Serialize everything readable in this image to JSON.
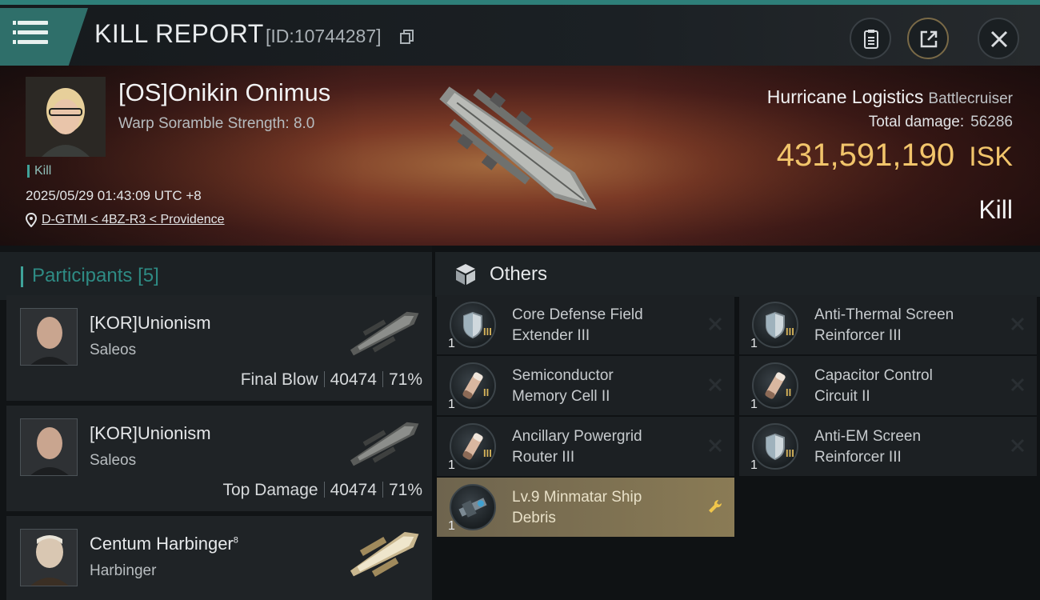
{
  "header": {
    "title": "KILL REPORT",
    "report_id": "[ID:10744287]"
  },
  "victim": {
    "name": "[OS]Onikin Onimus",
    "warp_scramble": "Warp Soramble Strength: 8.0",
    "kill_tag": "Kill",
    "timestamp": "2025/05/29 01:43:09 UTC +8",
    "location": "D-GTMI < 4BZ-R3 < Providence",
    "ship": "Hurricane Logistics",
    "ship_class": "Battlecruiser",
    "total_damage_label": "Total damage:",
    "total_damage": "56286",
    "isk_value": "431,591,190",
    "isk_unit": "ISK",
    "result": "Kill"
  },
  "participants": {
    "label": "Participants",
    "count": "[5]",
    "rows": [
      {
        "name": "[KOR]Unionism",
        "ship": "Saleos",
        "role": "Final Blow",
        "damage": "40474",
        "percent": "71%"
      },
      {
        "name": "[KOR]Unionism",
        "ship": "Saleos",
        "role": "Top Damage",
        "damage": "40474",
        "percent": "71%"
      },
      {
        "name": "Centum Harbinger",
        "name_sup": "8",
        "ship": "Harbinger"
      }
    ]
  },
  "others": {
    "label": "Others",
    "items": [
      {
        "name": "Core Defense Field Extender III",
        "line1": "Core Defense Field",
        "line2": "Extender III",
        "qty": "1",
        "tier": "III",
        "icon": "shield-module-icon",
        "status": "destroyed"
      },
      {
        "name": "Anti-Thermal Screen Reinforcer III",
        "line1": "Anti-Thermal Screen",
        "line2": "Reinforcer III",
        "qty": "1",
        "tier": "III",
        "icon": "shield-module-icon",
        "status": "destroyed"
      },
      {
        "name": "Semiconductor Memory Cell II",
        "line1": "Semiconductor",
        "line2": "Memory Cell II",
        "qty": "1",
        "tier": "II",
        "icon": "capacitor-module-icon",
        "status": "destroyed"
      },
      {
        "name": "Capacitor Control Circuit II",
        "line1": "Capacitor Control",
        "line2": "Circuit II",
        "qty": "1",
        "tier": "II",
        "icon": "capacitor-module-icon",
        "status": "destroyed"
      },
      {
        "name": "Ancillary Powergrid Router III",
        "line1": "Ancillary Powergrid",
        "line2": "Router III",
        "qty": "1",
        "tier": "III",
        "icon": "capacitor-module-icon",
        "status": "destroyed"
      },
      {
        "name": "Anti-EM Screen Reinforcer III",
        "line1": "Anti-EM Screen",
        "line2": "Reinforcer III",
        "qty": "1",
        "tier": "III",
        "icon": "shield-module-icon",
        "status": "destroyed"
      },
      {
        "name": "Lv.9 Minmatar Ship Debris",
        "line1": "Lv.9 Minmatar Ship",
        "line2": "Debris",
        "qty": "1",
        "icon": "debris-icon",
        "status": "salvage"
      }
    ]
  },
  "colors": {
    "accent_teal": "#2f6f6a",
    "isk_gold": "#f2c56b",
    "debris_highlight": "#8a7b55"
  }
}
